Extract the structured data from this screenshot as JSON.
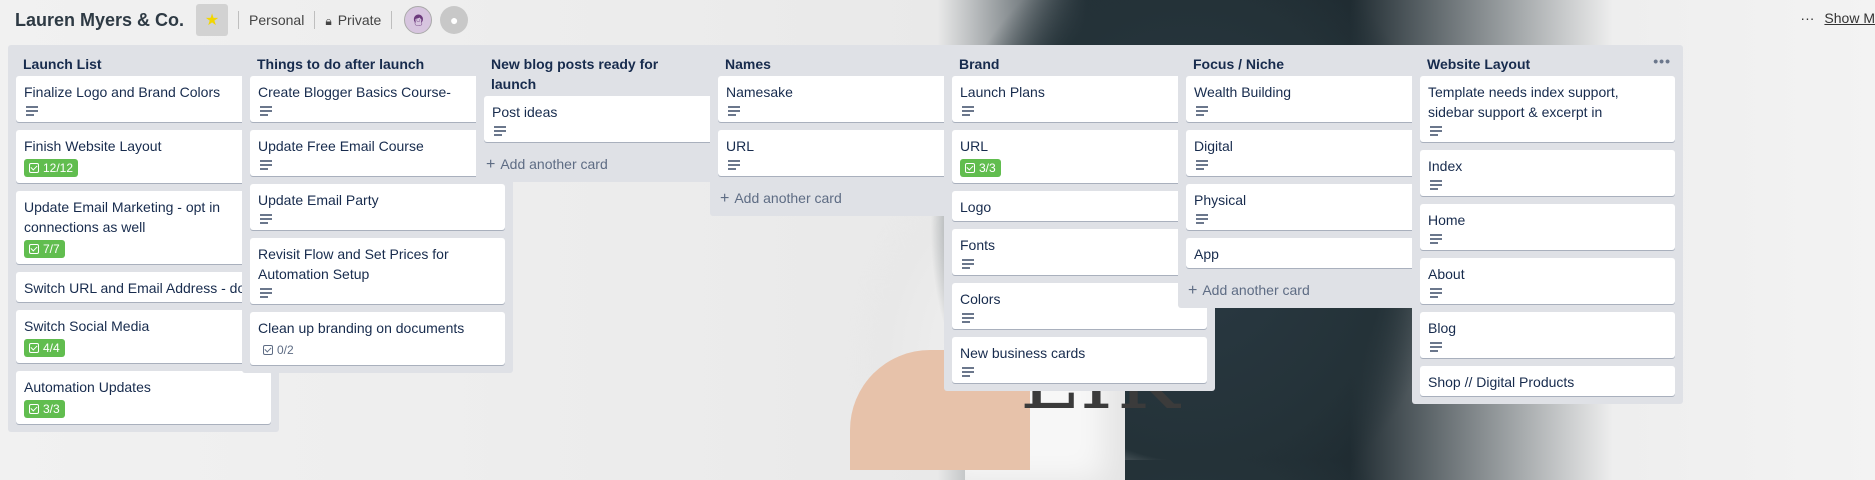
{
  "header": {
    "board_title": "Lauren Myers & Co.",
    "team_label": "Personal",
    "visibility_label": "Private",
    "show_menu_label": "Show M"
  },
  "lists": [
    {
      "title": "Launch List",
      "cards": [
        {
          "title": "Finalize Logo and Brand Colors",
          "has_description": true
        },
        {
          "title": "Finish Website Layout",
          "checklist": "12/12"
        },
        {
          "title": "Update Email Marketing - opt in connections as well",
          "checklist": "7/7"
        },
        {
          "title": "Switch URL and Email Address - done"
        },
        {
          "title": "Switch Social Media",
          "checklist": "4/4"
        },
        {
          "title": "Automation Updates",
          "checklist": "3/3"
        }
      ]
    },
    {
      "title": "Things to do after launch",
      "cards": [
        {
          "title": "Create Blogger Basics Course-",
          "has_description": true
        },
        {
          "title": "Update Free Email Course",
          "has_description": true
        },
        {
          "title": "Update Email Party",
          "has_description": true
        },
        {
          "title": "Revisit Flow and Set Prices for Automation Setup",
          "has_description": true
        },
        {
          "title": "Clean up branding on documents",
          "checklist": "0/2",
          "checklist_incomplete": true
        }
      ]
    },
    {
      "title": "New blog posts ready for launch",
      "cards": [
        {
          "title": "Post ideas",
          "has_description": true
        }
      ],
      "add_card_label": "Add another card"
    },
    {
      "title": "Names",
      "cards": [
        {
          "title": "Namesake",
          "has_description": true
        },
        {
          "title": "URL",
          "has_description": true
        }
      ],
      "add_card_label": "Add another card"
    },
    {
      "title": "Brand",
      "cards": [
        {
          "title": "Launch Plans",
          "has_description": true
        },
        {
          "title": "URL",
          "checklist": "3/3"
        },
        {
          "title": "Logo"
        },
        {
          "title": "Fonts",
          "has_description": true
        },
        {
          "title": "Colors",
          "has_description": true
        },
        {
          "title": "New business cards",
          "has_description": true
        }
      ]
    },
    {
      "title": "Focus / Niche",
      "cards": [
        {
          "title": "Wealth Building",
          "has_description": true
        },
        {
          "title": "Digital",
          "has_description": true
        },
        {
          "title": "Physical",
          "has_description": true
        },
        {
          "title": "App"
        }
      ],
      "add_card_label": "Add another card"
    },
    {
      "title": "Website Layout",
      "cards": [
        {
          "title": "Template needs index support, sidebar support & excerpt in",
          "has_description": true
        },
        {
          "title": "Index",
          "has_description": true
        },
        {
          "title": "Home",
          "has_description": true
        },
        {
          "title": "About",
          "has_description": true
        },
        {
          "title": "Blog",
          "has_description": true
        },
        {
          "title": "Shop // Digital Products"
        }
      ]
    }
  ],
  "colors": {
    "checklist_complete": "#61bd4f",
    "list_background": "#dfe1e6",
    "star": "#f2d600"
  }
}
